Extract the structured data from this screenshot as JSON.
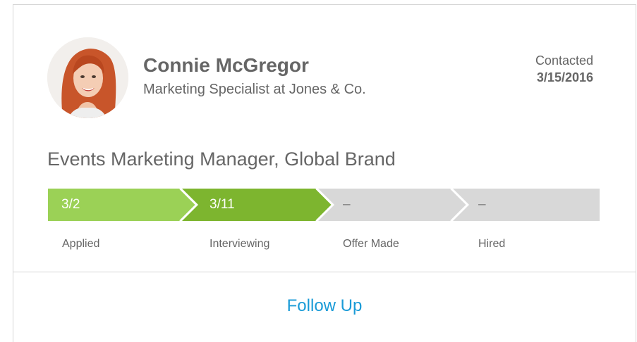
{
  "candidate": {
    "name": "Connie McGregor",
    "title": "Marketing Specialist at Jones & Co.",
    "contacted_label": "Contacted",
    "contacted_date": "3/15/2016"
  },
  "job": {
    "title": "Events Marketing Manager, Global Brand"
  },
  "pipeline": {
    "stages": [
      {
        "label": "Applied",
        "value": "3/2",
        "status": "complete",
        "color": "#9bd156"
      },
      {
        "label": "Interviewing",
        "value": "3/11",
        "status": "current",
        "color": "#7db52f"
      },
      {
        "label": "Offer Made",
        "value": "–",
        "status": "pending",
        "color": "#d8d8d8"
      },
      {
        "label": "Hired",
        "value": "–",
        "status": "pending",
        "color": "#d8d8d8"
      }
    ]
  },
  "actions": {
    "follow_up": "Follow Up"
  },
  "colors": {
    "text": "#666666",
    "link": "#1a9bd7",
    "border": "#d6d6d6"
  }
}
